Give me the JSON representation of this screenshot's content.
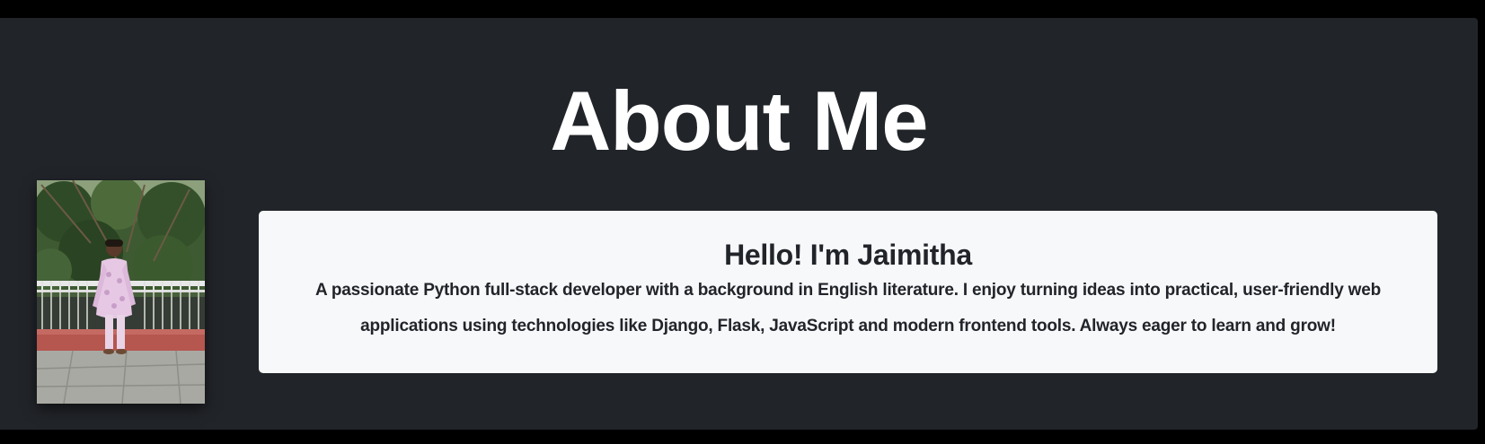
{
  "about": {
    "title": "About Me",
    "photo_alt": "Profile photo of Jaimitha",
    "card": {
      "heading": "Hello! I'm Jaimitha",
      "text": "A passionate Python full-stack developer with a background in English literature. I enjoy turning ideas into practical, user-friendly web applications using technologies like Django, Flask, JavaScript and modern frontend tools. Always eager to learn and grow!"
    }
  },
  "colors": {
    "page_background": "#000000",
    "section_background": "#212429",
    "title_text": "#ffffff",
    "card_background": "#f7f8fa",
    "card_text": "#212429"
  }
}
